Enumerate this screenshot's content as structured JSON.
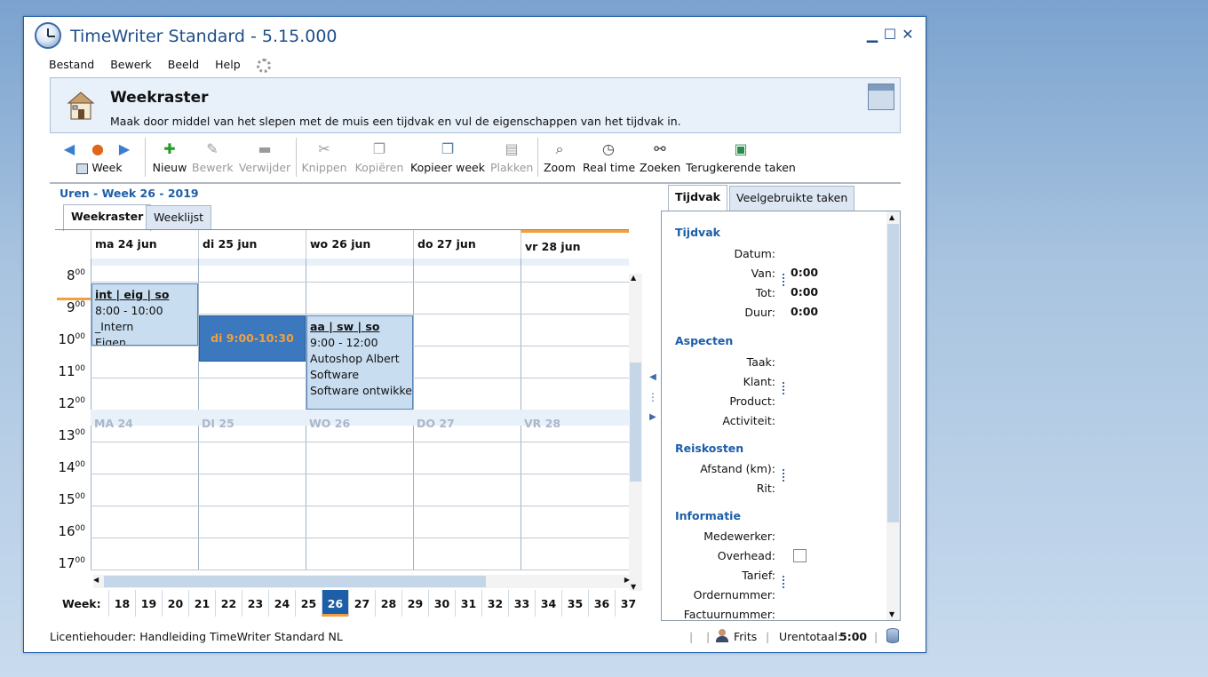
{
  "window": {
    "title": "TimeWriter Standard - 5.15.000",
    "controls": {
      "minimize": "▁",
      "maximize": "☐",
      "close": "✕"
    }
  },
  "menu": [
    "Bestand",
    "Bewerk",
    "Beeld",
    "Help"
  ],
  "header": {
    "title": "Weekraster",
    "description": "Maak door middel van het slepen met de muis een tijdvak en vul de eigenschappen van het tijdvak in."
  },
  "toolbar": {
    "period_label": "Week",
    "buttons": [
      {
        "label": "Nieuw",
        "icon": "plus-icon",
        "enabled": true
      },
      {
        "label": "Bewerk",
        "icon": "pencil-icon",
        "enabled": false
      },
      {
        "label": "Verwijder",
        "icon": "minus-icon",
        "enabled": false
      },
      {
        "label": "Knippen",
        "icon": "scissors-icon",
        "enabled": false
      },
      {
        "label": "Kopiëren",
        "icon": "copy-icon",
        "enabled": false
      },
      {
        "label": "Kopieer week",
        "icon": "copy-week-icon",
        "enabled": true
      },
      {
        "label": "Plakken",
        "icon": "paste-icon",
        "enabled": false
      },
      {
        "label": "Zoom",
        "icon": "magnifier-icon",
        "enabled": true
      },
      {
        "label": "Real time",
        "icon": "clock-icon",
        "enabled": true
      },
      {
        "label": "Zoeken",
        "icon": "binoculars-icon",
        "enabled": true
      },
      {
        "label": "Terugkerende taken",
        "icon": "recurring-icon",
        "enabled": true
      }
    ]
  },
  "uren_title": "Uren - Week 26 - 2019",
  "view_tabs": [
    "Weekraster",
    "Weeklijst"
  ],
  "days": [
    "ma 24 jun",
    "di 25 jun",
    "wo 26 jun",
    "do 27 jun",
    "vr 28 jun"
  ],
  "day_strip": [
    "MA 24",
    "DI 25",
    "WO 26",
    "DO 27",
    "VR 28"
  ],
  "hours": [
    "8",
    "9",
    "10",
    "11",
    "12",
    "13",
    "14",
    "15",
    "16",
    "17"
  ],
  "hour_suffix": "00",
  "events": [
    {
      "title": "int | eig | so",
      "time": "8:00 - 10:00",
      "line1": "_Intern",
      "line2": "Eigen"
    },
    {
      "title": "aa | sw | so",
      "time": "9:00 - 12:00",
      "line1": "Autoshop Albert",
      "line2": "Software",
      "line3": "Software ontwikkeling"
    }
  ],
  "selection": "di 9:00-10:30",
  "weekbar": {
    "label": "Week:",
    "weeks": [
      "18",
      "19",
      "20",
      "21",
      "22",
      "23",
      "24",
      "25",
      "26",
      "27",
      "28",
      "29",
      "30",
      "31",
      "32",
      "33",
      "34",
      "35",
      "36",
      "37"
    ],
    "active": "26"
  },
  "right_tabs": [
    "Tijdvak",
    "Veelgebruikte taken"
  ],
  "props": {
    "tijdvak": {
      "title": "Tijdvak",
      "datum": "Datum:",
      "van": "Van:",
      "van_val": "0:00",
      "tot": "Tot:",
      "tot_val": "0:00",
      "duur": "Duur:",
      "duur_val": "0:00"
    },
    "aspecten": {
      "title": "Aspecten",
      "taak": "Taak:",
      "klant": "Klant:",
      "product": "Product:",
      "activiteit": "Activiteit:"
    },
    "reiskosten": {
      "title": "Reiskosten",
      "afstand": "Afstand (km):",
      "rit": "Rit:"
    },
    "informatie": {
      "title": "Informatie",
      "medewerker": "Medewerker:",
      "overhead": "Overhead:",
      "tarief": "Tarief:",
      "ordernummer": "Ordernummer:",
      "factuurnummer": "Factuurnummer:"
    }
  },
  "status": {
    "license": "Licentiehouder: Handleiding TimeWriter Standard NL",
    "user": "Frits",
    "total_label": "Urentotaal:",
    "total_value": "5:00"
  }
}
